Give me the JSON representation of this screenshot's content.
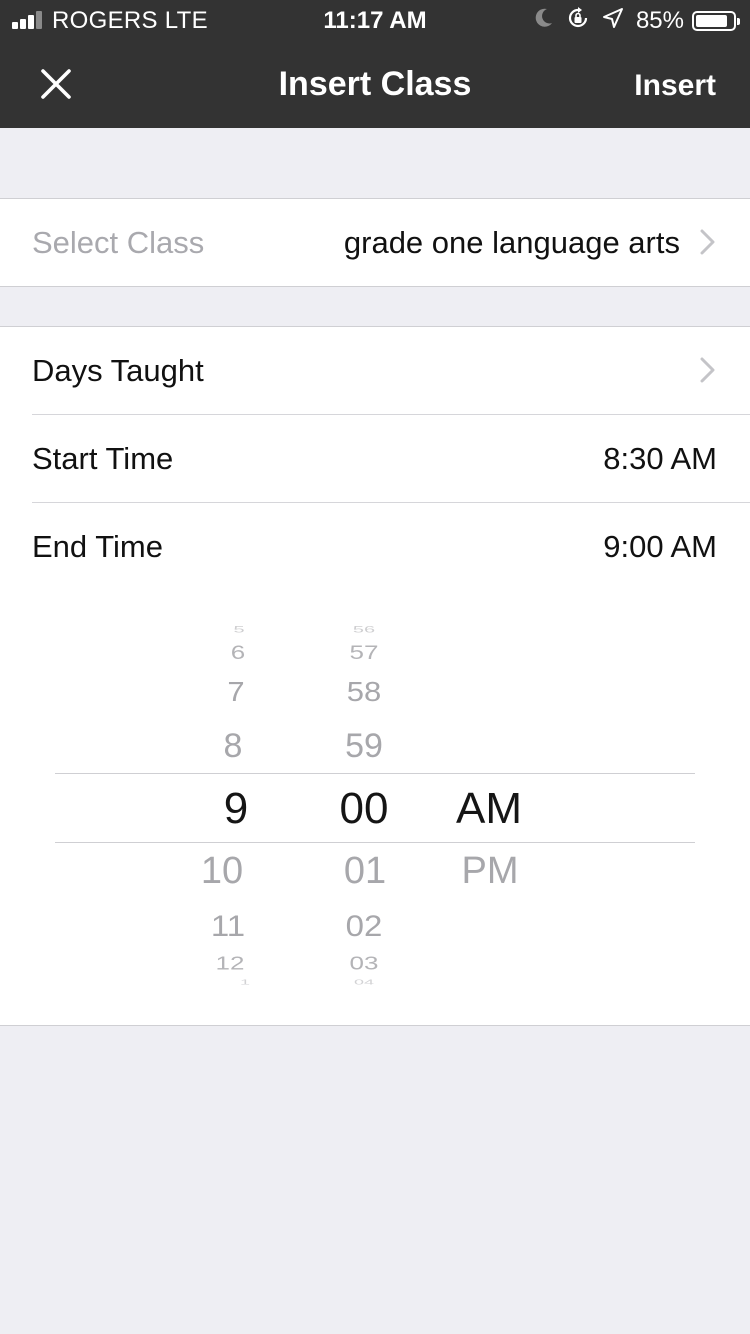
{
  "status_bar": {
    "carrier": "ROGERS  LTE",
    "time": "11:17 AM",
    "battery_percent": "85%",
    "battery_level": 0.85,
    "signal_bars": 3,
    "icons": [
      "moon-icon",
      "orientation-lock-icon",
      "location-arrow-icon"
    ]
  },
  "nav": {
    "close_icon": "close-icon",
    "title": "Insert Class",
    "insert_label": "Insert"
  },
  "class_section": {
    "label": "Select Class",
    "value": "grade one language arts"
  },
  "schedule_section": {
    "days_label": "Days Taught",
    "start_label": "Start Time",
    "start_value": "8:30 AM",
    "end_label": "End Time",
    "end_value": "9:00 AM"
  },
  "picker": {
    "hours": [
      "5",
      "6",
      "7",
      "8",
      "9",
      "10",
      "11",
      "12",
      "1"
    ],
    "minutes": [
      "56",
      "57",
      "58",
      "59",
      "00",
      "01",
      "02",
      "03",
      "04"
    ],
    "periods": [
      "AM",
      "PM"
    ],
    "selected": {
      "hour": "9",
      "minute": "00",
      "period": "AM"
    }
  },
  "colors": {
    "nav_background": "#333333",
    "page_background": "#eeeef3",
    "muted_text": "#a9a9ae"
  }
}
